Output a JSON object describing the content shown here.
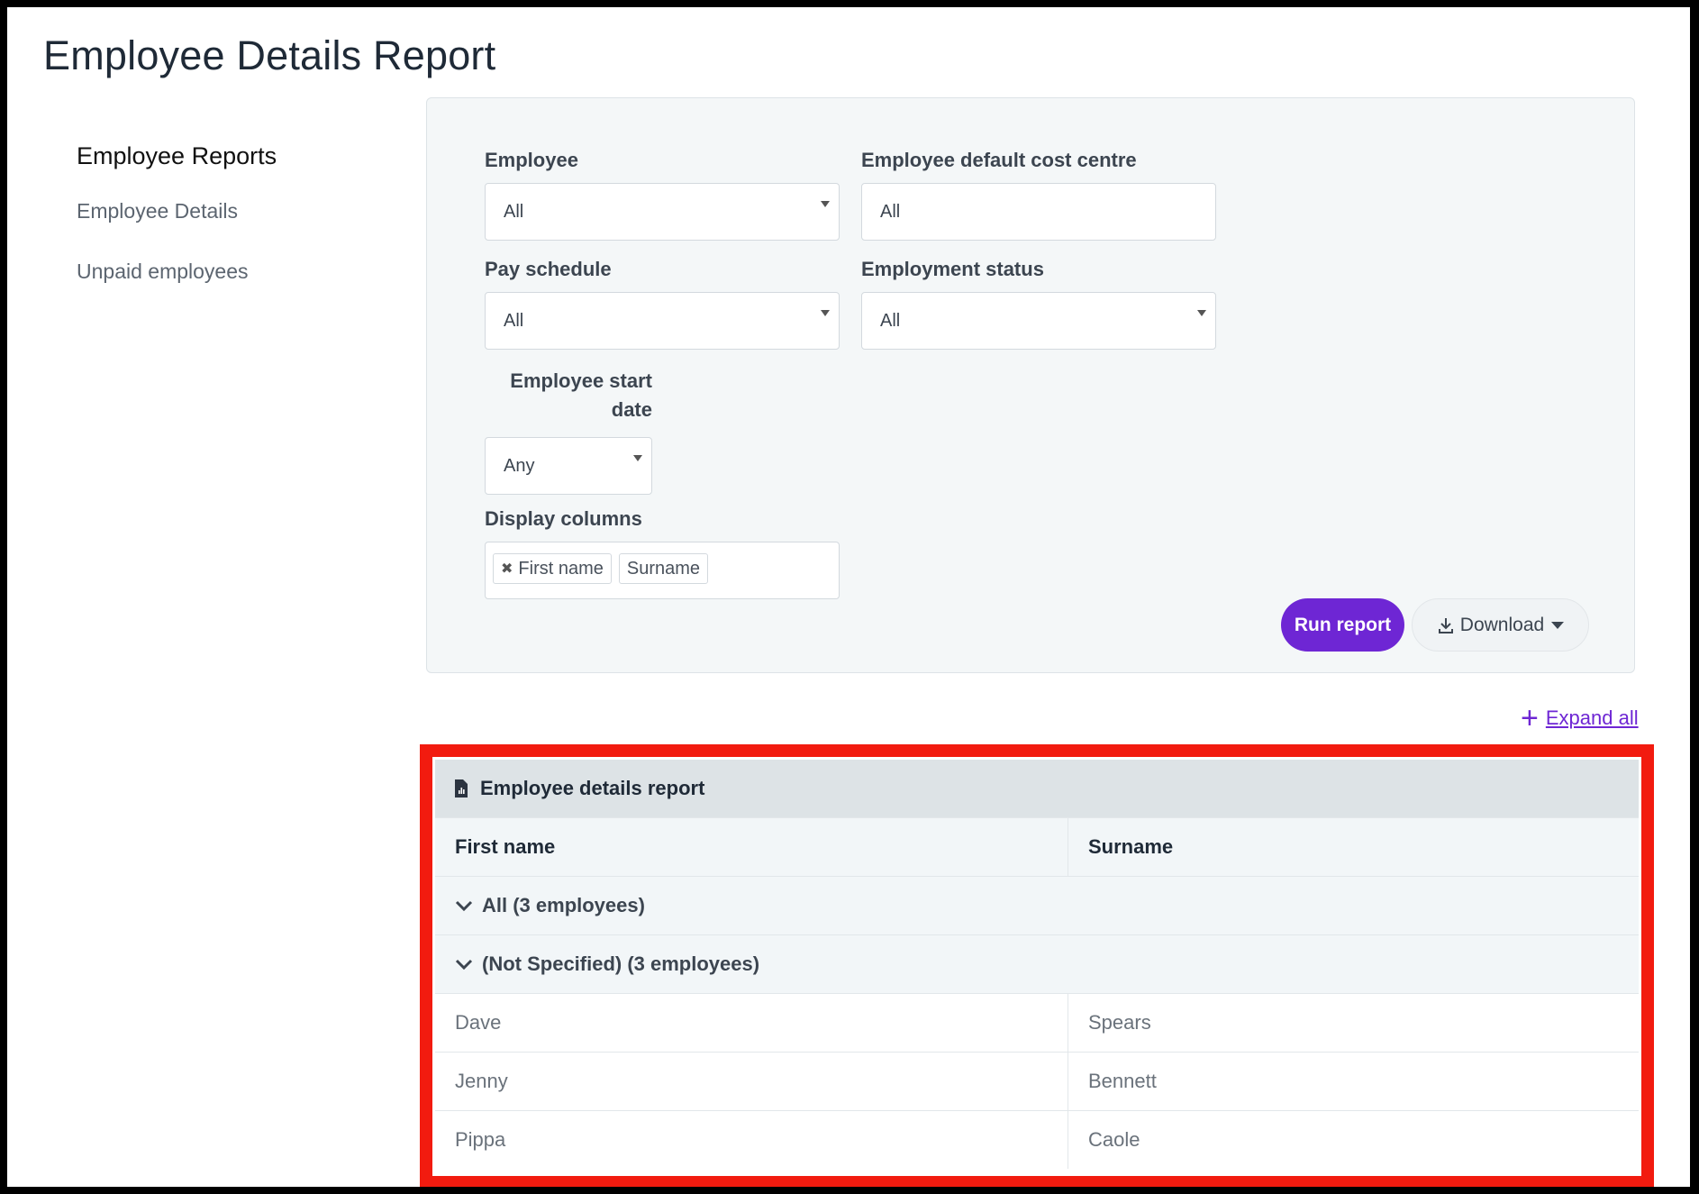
{
  "page": {
    "title": "Employee Details Report"
  },
  "sidebar": {
    "heading": "Employee Reports",
    "items": [
      {
        "label": "Employee Details"
      },
      {
        "label": "Unpaid employees"
      }
    ]
  },
  "filters": {
    "employee": {
      "label": "Employee",
      "value": "All"
    },
    "cost_centre": {
      "label": "Employee default cost centre",
      "value": "All"
    },
    "pay_schedule": {
      "label": "Pay schedule",
      "value": "All"
    },
    "employment_status": {
      "label": "Employment status",
      "value": "All"
    },
    "start_date": {
      "label_line1": "Employee start",
      "label_line2": "date",
      "value": "Any"
    },
    "display_columns": {
      "label": "Display columns",
      "tags": [
        "First name",
        "Surname"
      ]
    }
  },
  "actions": {
    "run_label": "Run report",
    "download_label": "Download",
    "expand_all_label": "Expand all"
  },
  "report": {
    "title": "Employee details report",
    "columns": [
      "First name",
      "Surname"
    ],
    "groups": [
      "All (3 employees)",
      "(Not Specified) (3 employees)"
    ],
    "rows": [
      [
        "Dave",
        "Spears"
      ],
      [
        "Jenny",
        "Bennett"
      ],
      [
        "Pippa",
        "Caole"
      ]
    ]
  },
  "colors": {
    "accent": "#6e26d4",
    "highlight": "#f21b0f"
  }
}
